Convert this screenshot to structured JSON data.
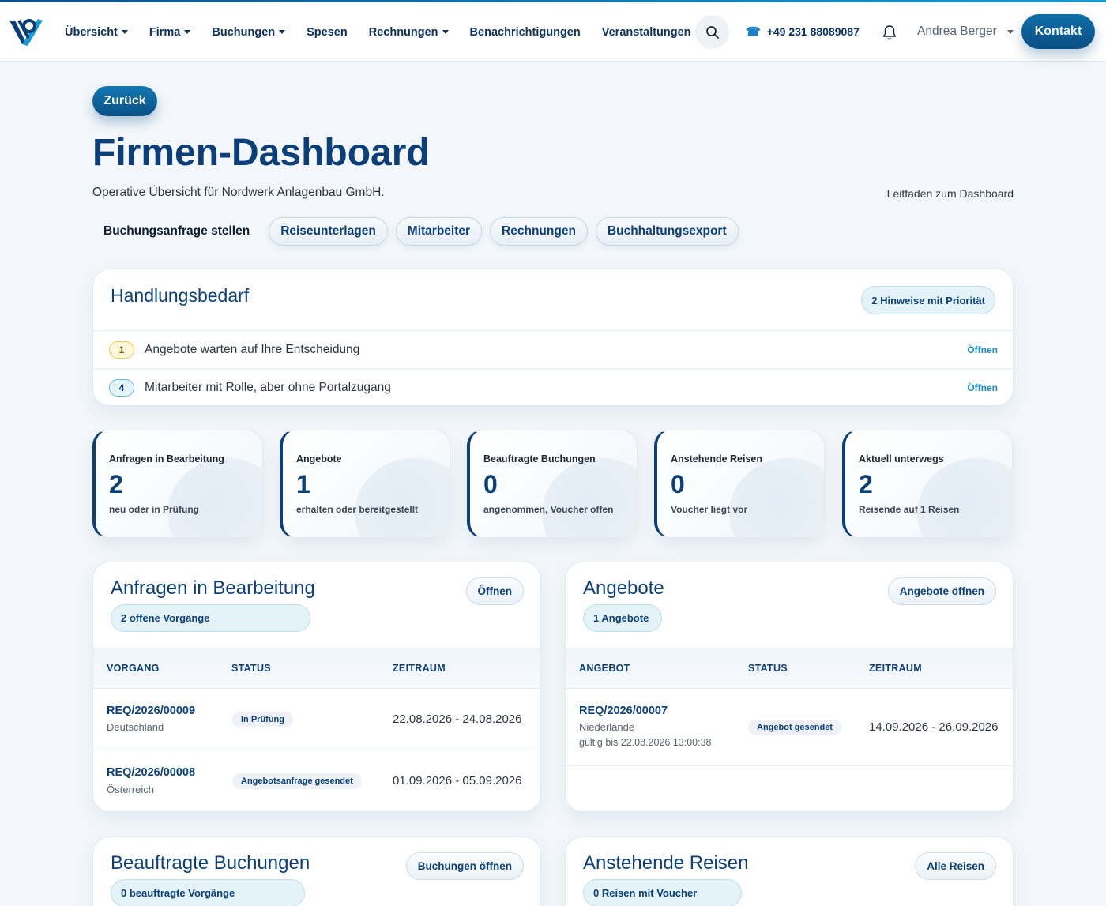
{
  "nav": {
    "items": [
      {
        "label": "Übersicht",
        "dropdown": true
      },
      {
        "label": "Firma",
        "dropdown": true
      },
      {
        "label": "Buchungen",
        "dropdown": true
      },
      {
        "label": "Spesen",
        "dropdown": false
      },
      {
        "label": "Rechnungen",
        "dropdown": true
      },
      {
        "label": "Benachrichtigungen",
        "dropdown": false
      },
      {
        "label": "Veranstaltungen",
        "dropdown": false
      }
    ],
    "phone": "+49 231 88089087",
    "user": "Andrea Berger",
    "contact_label": "Kontakt"
  },
  "page": {
    "back_label": "Zurück",
    "title": "Firmen-Dashboard",
    "subtitle": "Operative Übersicht für Nordwerk Anlagenbau GmbH.",
    "guide_link": "Leitfaden zum Dashboard",
    "actions": [
      "Buchungsanfrage stellen",
      "Reiseunterlagen",
      "Mitarbeiter",
      "Rechnungen",
      "Buchhaltungsexport"
    ]
  },
  "action_needed": {
    "title": "Handlungsbedarf",
    "badge": "2 Hinweise mit Priorität",
    "rows": [
      {
        "count": "1",
        "text": "Angebote warten auf Ihre Entscheidung",
        "link": "Öffnen"
      },
      {
        "count": "4",
        "text": "Mitarbeiter mit Rolle, aber ohne Portalzugang",
        "link": "Öffnen"
      }
    ]
  },
  "kpis": [
    {
      "label": "Anfragen in Bearbeitung",
      "value": "2",
      "sub": "neu oder in Prüfung"
    },
    {
      "label": "Angebote",
      "value": "1",
      "sub": "erhalten oder bereitgestellt"
    },
    {
      "label": "Beauftragte Buchungen",
      "value": "0",
      "sub": "angenommen, Voucher offen"
    },
    {
      "label": "Anstehende Reisen",
      "value": "0",
      "sub": "Voucher liegt vor"
    },
    {
      "label": "Aktuell unterwegs",
      "value": "2",
      "sub": "Reisende auf 1 Reisen"
    }
  ],
  "requests": {
    "title": "Anfragen in Bearbeitung",
    "badge": "2 offene Vorgänge",
    "button": "Öffnen",
    "columns": [
      "VORGANG",
      "STATUS",
      "ZEITRAUM"
    ],
    "rows": [
      {
        "ref": "REQ/2026/00009",
        "country": "Deutschland",
        "status": "In Prüfung",
        "period": "22.08.2026 - 24.08.2026"
      },
      {
        "ref": "REQ/2026/00008",
        "country": "Österreich",
        "status": "Angebotsanfrage gesendet",
        "period": "01.09.2026 - 05.09.2026"
      }
    ]
  },
  "offers": {
    "title": "Angebote",
    "badge": "1 Angebote",
    "button": "Angebote öffnen",
    "columns": [
      "ANGEBOT",
      "STATUS",
      "ZEITRAUM"
    ],
    "rows": [
      {
        "ref": "REQ/2026/00007",
        "country": "Niederlande",
        "valid": "gültig bis 22.08.2026 13:00:38",
        "status": "Angebot gesendet",
        "period": "14.09.2026 - 26.09.2026"
      }
    ]
  },
  "bookings": {
    "title": "Beauftragte Buchungen",
    "badge": "0 beauftragte Vorgänge",
    "button": "Buchungen öffnen"
  },
  "upcoming": {
    "title": "Anstehende Reisen",
    "badge": "0 Reisen mit Voucher",
    "button": "Alle Reisen"
  },
  "colors": {
    "primary": "#0b3f7a",
    "accent": "#1a8fc2",
    "badge_bg": "#e4f3f8",
    "warning": "#f2c94c"
  },
  "icons": [
    "logo-icon",
    "search-icon",
    "phone-icon",
    "bell-icon",
    "chevron-down-icon"
  ]
}
